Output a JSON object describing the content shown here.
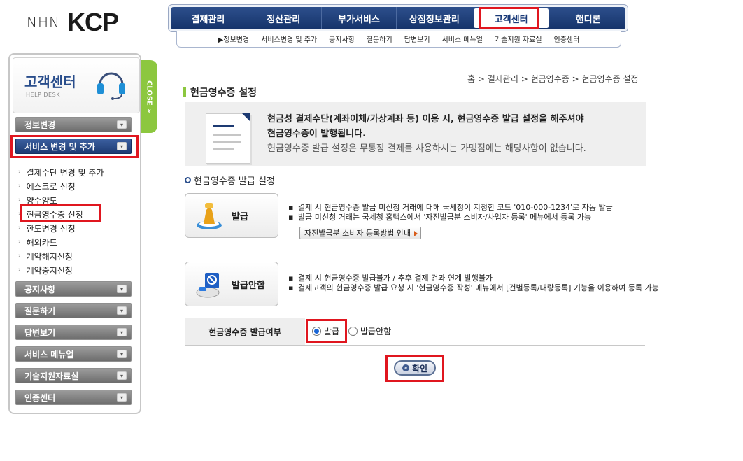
{
  "logo": {
    "prefix": "NHN",
    "brand": "KCP"
  },
  "topnav": {
    "items": [
      "결제관리",
      "정산관리",
      "부가서비스",
      "상점정보관리",
      "고객센터",
      "핸디론"
    ],
    "active_index": 4
  },
  "subnav": {
    "items": [
      "▶정보변경",
      "서비스변경 및 추가",
      "공지사항",
      "질문하기",
      "답변보기",
      "서비스 메뉴얼",
      "기술지원 자료실",
      "인증센터"
    ]
  },
  "sidebar": {
    "title": "고객센터",
    "subtitle": "HELP DESK",
    "close_label": "CLOSE",
    "close_glyph": "»",
    "chev": "▾",
    "menu_top": [
      {
        "label": "정보변경"
      },
      {
        "label": "서비스 변경 및 추가",
        "active": true
      }
    ],
    "subitems": [
      "결제수단 변경 및 추가",
      "에스크로 신청",
      "양수양도",
      "현금영수증 신청",
      "한도변경 신청",
      "해외카드",
      "계약해지신청",
      "계약중지신청"
    ],
    "menu_bottom": [
      {
        "label": "공지사항"
      },
      {
        "label": "질문하기"
      },
      {
        "label": "답변보기"
      },
      {
        "label": "서비스 메뉴얼"
      },
      {
        "label": "기술지원자료실"
      },
      {
        "label": "인증센터"
      }
    ]
  },
  "breadcrumb": "홈 > 결제관리 > 현금영수증 > 현금영수증 설정",
  "page_title": "현금영수증 설정",
  "notice": {
    "line1": "현금성 결제수단(계좌이체/가상계좌 등) 이용 시, 현금영수증 발급 설정을 해주셔야",
    "line2": "현금영수증이 발행됩니다.",
    "line3": "현금영수증 발급 설정은 무통장 결제를 사용하시는 가맹점에는 해당사항이 없습니다."
  },
  "section_label": "현금영수증 발급 설정",
  "options": {
    "issue": {
      "label": "발급",
      "bullet": "▪",
      "desc1": "결제 시 현금영수증 발급 미신청 거래에 대해 국세청이 지정한 코드 '010-000-1234'로 자동 발급",
      "desc2": "발급 미신청 거래는 국세청 홈택스에서 '자진발급분 소비자/사업자 등록' 메뉴에서 등록 가능",
      "guide_button": "자진발급분 소비자 등록방법 안내"
    },
    "no_issue": {
      "label": "발급안함",
      "desc1": "결제 시 현금영수증 발급불가 / 추후 결제 건과 연계 발행불가",
      "desc2": "결제고객의 현금영수증 발급 요청 시 '현금영수증 작성' 메뉴에서 [건별등록/대량등록] 기능을 이용하여 등록 가능"
    }
  },
  "issue_row": {
    "label": "현금영수증 발급여부",
    "radio_issue": "발급",
    "radio_no_issue": "발급안함",
    "selected": "발급"
  },
  "confirm_button": "확인",
  "confirm_glyph": "»",
  "colors": {
    "nav_blue": "#15336a",
    "accent_green": "#8cc73f",
    "highlight_red": "#e0161f"
  }
}
